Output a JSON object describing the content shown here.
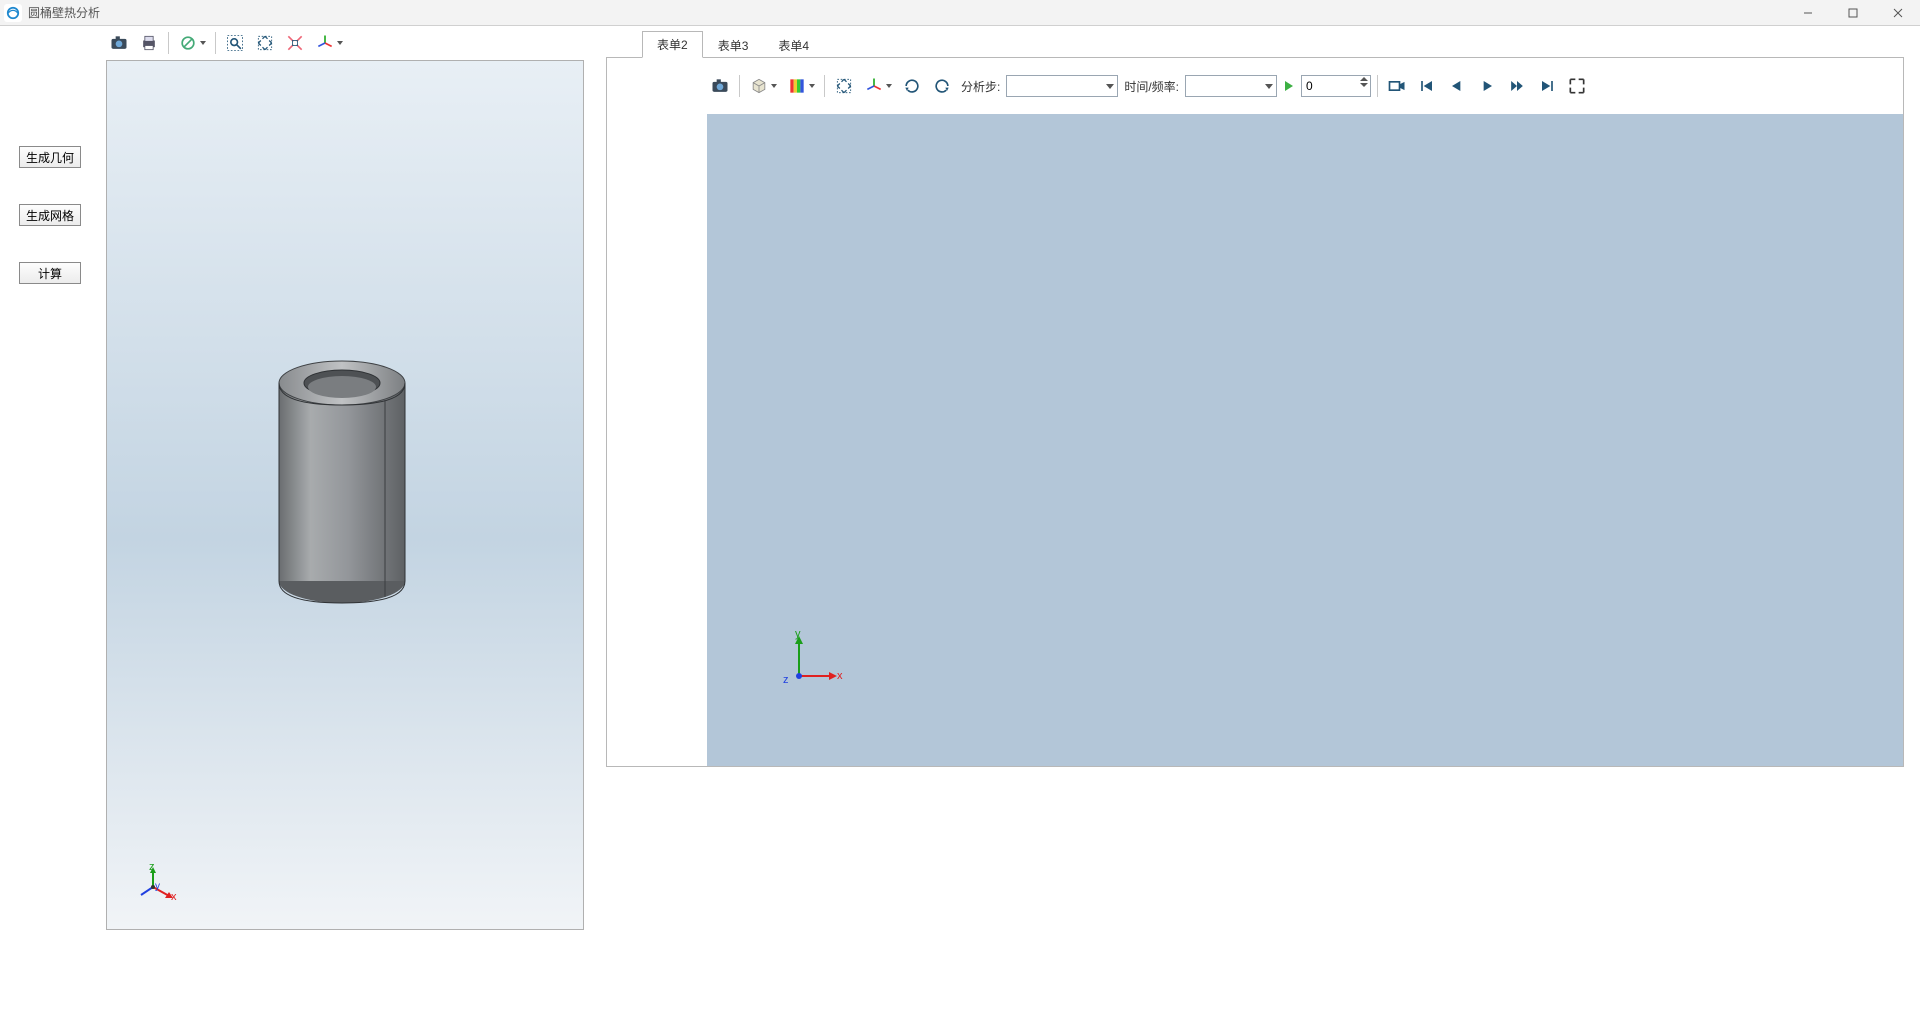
{
  "window": {
    "title": "圆桶壁热分析"
  },
  "sidebar": {
    "buttons": [
      "生成几何",
      "生成网格",
      "计算"
    ]
  },
  "tabs": [
    "表单2",
    "表单3",
    "表单4"
  ],
  "rightToolbar": {
    "analysisStepLabel": "分析步:",
    "timeFreqLabel": "时间/频率:",
    "stepperValue": "0"
  },
  "axes": {
    "x": "x",
    "y": "y",
    "z": "z"
  }
}
